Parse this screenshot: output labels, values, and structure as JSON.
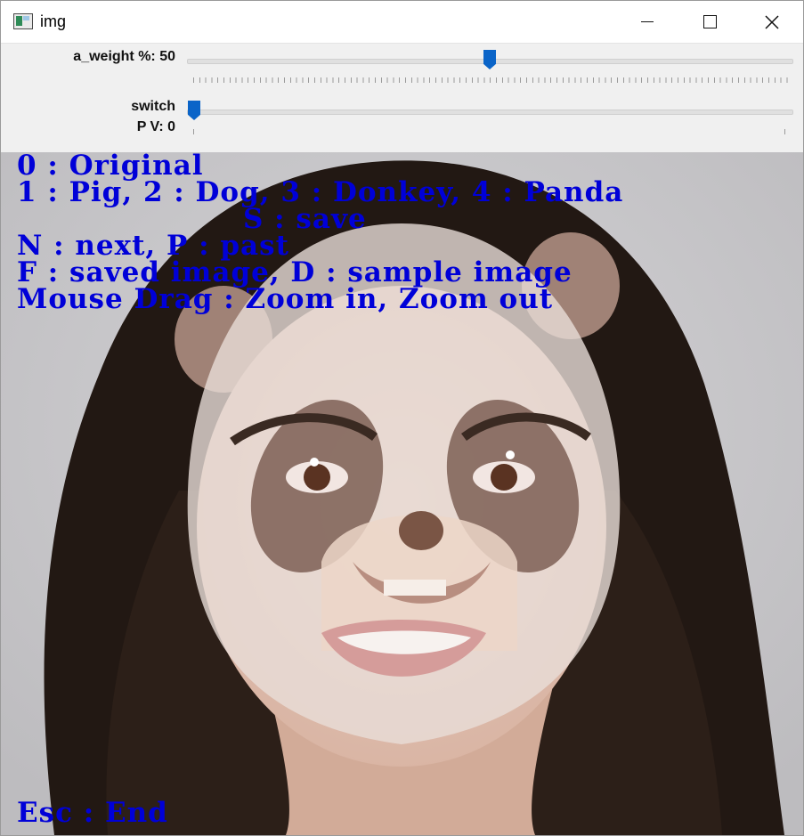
{
  "window": {
    "title": "img",
    "app_icon": "image-window-icon",
    "minimize_icon": "minimize-icon",
    "maximize_icon": "maximize-icon",
    "close_icon": "close-icon"
  },
  "trackbars": [
    {
      "label": "a_weight %: 50",
      "value": 50,
      "min": 0,
      "max": 100,
      "thumb_color": "#0a64c8"
    },
    {
      "label_line1": "switch",
      "label_line2": "P V: 0",
      "value": 0,
      "min": 0,
      "max": 1,
      "thumb_color": "#0a64c8"
    }
  ],
  "image": {
    "description_icon": "face-with-panda-mask-image",
    "overlay_color": "#0000d8",
    "lines": [
      "0 : Original",
      "1 : Pig, 2 : Dog, 3 : Donkey, 4 : Panda",
      "S : save",
      "N : next, P : past",
      "F : saved image, D : sample image",
      "Mouse Drag : Zoom in, Zoom out"
    ],
    "footer": "Esc : End"
  }
}
